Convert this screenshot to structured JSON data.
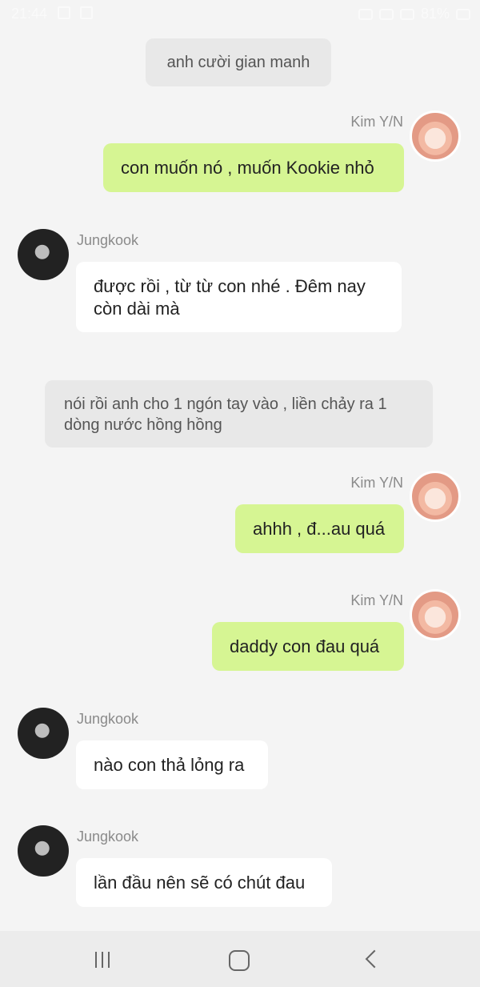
{
  "status_bar": {
    "time": "21:44",
    "battery": "81%"
  },
  "messages": [
    {
      "kind": "narration",
      "text": "anh cười gian manh"
    },
    {
      "kind": "me",
      "sender": "Kim Y/N",
      "text": "con muốn nó , muốn Kookie nhỏ"
    },
    {
      "kind": "them",
      "sender": "Jungkook",
      "text": "được rồi , từ từ con nhé . Đêm nay còn dài mà"
    },
    {
      "kind": "narration",
      "text": "nói rồi anh cho 1 ngón tay vào , liền chảy ra 1 dòng nước hồng hồng"
    },
    {
      "kind": "me",
      "sender": "Kim Y/N",
      "text": "ahhh , đ...au quá"
    },
    {
      "kind": "me",
      "sender": "Kim Y/N",
      "text": "daddy con đau quá"
    },
    {
      "kind": "them",
      "sender": "Jungkook",
      "text": "nào con thả lỏng ra"
    },
    {
      "kind": "them",
      "sender": "Jungkook",
      "text": "lần đầu nên sẽ có chút đau"
    }
  ],
  "nav": {
    "recents_icon": "recents-icon",
    "home_icon": "home-icon",
    "back_icon": "back-icon"
  }
}
